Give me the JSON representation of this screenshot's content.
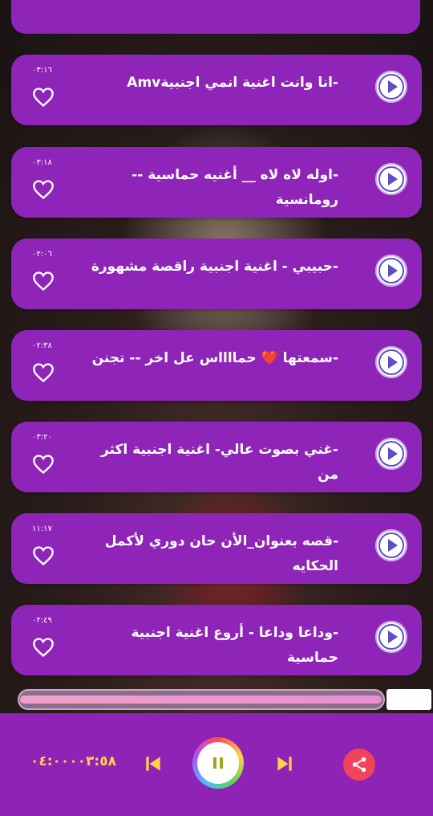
{
  "songs": [
    {
      "title": "-انا وانت اغنية انمي اجنبيةAmv",
      "duration": "٠٣:١٦"
    },
    {
      "title": "-اوله لاه لاه __ أغنيه حماسية -- رومانسية",
      "duration": "٠٣:١٨"
    },
    {
      "title": "-حبيبي - اغنية اجنبية راقصة مشهورة",
      "duration": "٠٢:٠٦"
    },
    {
      "title": "-سمعتها ❤️ حمااااس عل اخر -- تجنن",
      "duration": "٠٢:٣٨"
    },
    {
      "title": "-غني بصوت عالي- اغنية اجنبية اكثر من",
      "duration": "٠٣:٢٠"
    },
    {
      "title": "-قصه بعنوان_الأن حان دوري لأكمل الحكايه",
      "duration": "١١:١٧"
    },
    {
      "title": "-وداعا وداعا - أروع اغنية اجنبية حماسية",
      "duration": "٠٢:٤٩"
    }
  ],
  "player": {
    "time_display": "٠٤:٠٠٠٠٣:٥٨",
    "progress_fraction": 0.998
  },
  "icons": {
    "play": "play-icon",
    "heart": "heart-outline-icon",
    "previous": "skip-previous-icon",
    "pause": "pause-icon",
    "next": "skip-next-icon",
    "share": "share-icon"
  },
  "colors": {
    "card": "#8f25b8",
    "player_bar": "#8e23b6",
    "time_text": "#ffd24a",
    "controls": "#ffd24a",
    "share": "#f0445a",
    "play_icon": "#5b4fc5"
  }
}
